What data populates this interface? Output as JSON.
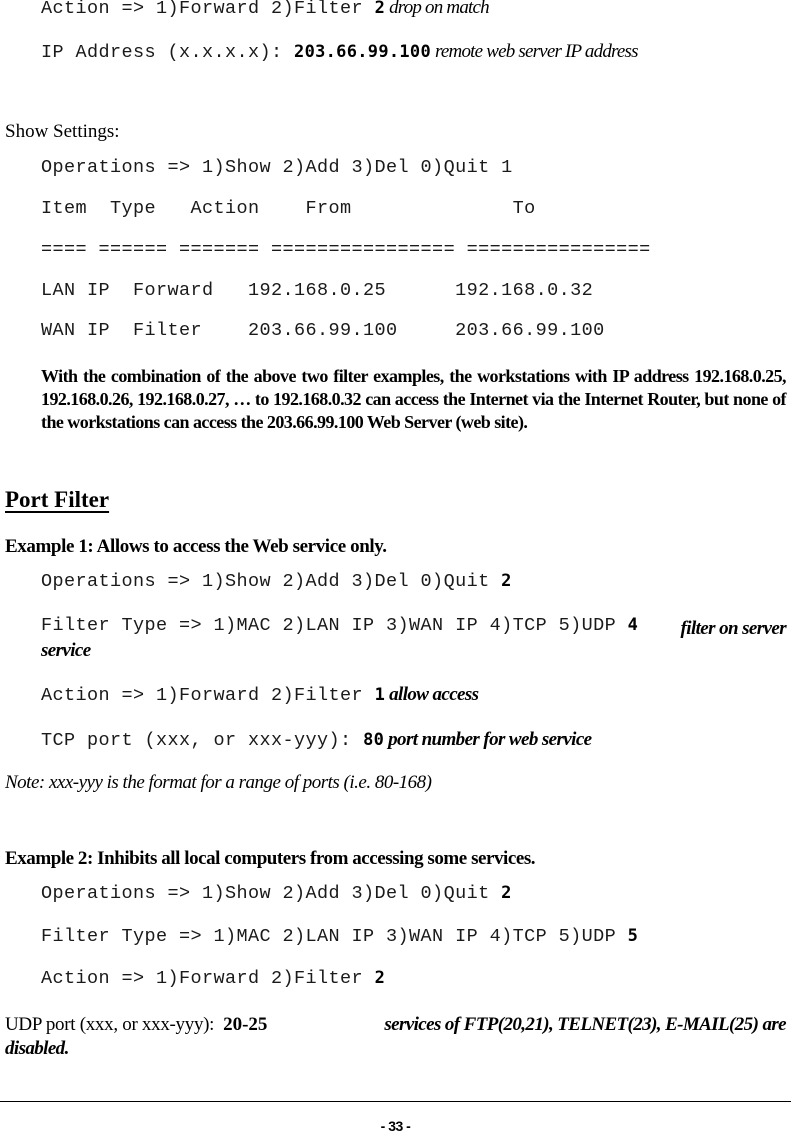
{
  "top_block": {
    "action_prompt": "Action => 1)Forward 2)Filter ",
    "action_value": "2",
    "action_note": "drop on match",
    "ip_prompt": "IP Address (x.x.x.x): ",
    "ip_value": "203.66.99.100",
    "ip_note": "remote web server IP address"
  },
  "show_settings": {
    "label": "Show Settings:",
    "operations_prompt": "Operations => 1)Show 2)Add 3)Del 0)Quit 1",
    "table_header": "Item  Type   Action    From              To",
    "table_separator": "==== ====== ======= ================ ================",
    "rows": [
      "LAN IP  Forward   192.168.0.25      192.168.0.32",
      "WAN IP  Filter    203.66.99.100     203.66.99.100"
    ],
    "explanation": "With the combination of the above two filter examples, the workstations with IP address 192.168.0.25, 192.168.0.26, 192.168.0.27, … to 192.168.0.32 can access the Internet via the Internet Router, but none of the workstations can access the 203.66.99.100 Web Server (web site)."
  },
  "port_filter": {
    "heading": "Port Filter",
    "example1": {
      "title": "Example 1: Allows to access the Web service only.",
      "operations_prompt": "Operations => 1)Show 2)Add 3)Del 0)Quit ",
      "operations_value": "2",
      "filter_type_prompt": "Filter Type => 1)MAC 2)LAN IP 3)WAN IP 4)TCP 5)UDP ",
      "filter_type_value": "4",
      "filter_type_note_line1": "filter on server",
      "filter_type_note_line2": "service",
      "action_prompt": "Action => 1)Forward 2)Filter ",
      "action_value": "1",
      "action_note": "allow access",
      "tcp_prompt": "TCP port (xxx, or xxx-yyy): ",
      "tcp_value": "80",
      "tcp_note": "port number for web service",
      "note": "Note: xxx-yyy is the format for a range of ports (i.e. 80-168)"
    },
    "example2": {
      "title": "Example 2: Inhibits all local computers from accessing some services.",
      "operations_prompt": "Operations => 1)Show 2)Add 3)Del 0)Quit ",
      "operations_value": "2",
      "filter_type_prompt": "Filter Type => 1)MAC 2)LAN IP 3)WAN IP 4)TCP 5)UDP ",
      "filter_type_value": "5",
      "action_prompt": "Action => 1)Forward 2)Filter ",
      "action_value": "2",
      "udp_prompt": "UDP port (xxx, or xxx-yyy):  ",
      "udp_value": "20-25",
      "udp_note_line1": "services of FTP(20,21), TELNET(23), E-MAIL(25) are",
      "udp_note_line2": "disabled."
    }
  },
  "footer": {
    "page_number": "- 33 -"
  }
}
